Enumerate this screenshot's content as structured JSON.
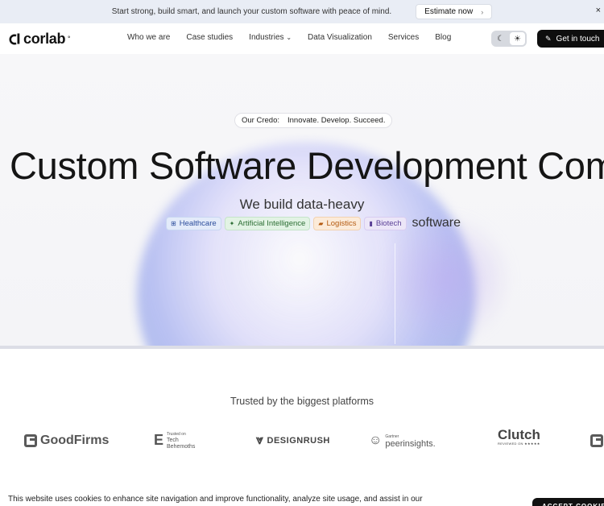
{
  "announcement": {
    "message": "Start strong, build smart, and launch your custom software with peace of mind.",
    "cta_label": "Estimate now",
    "close_symbol": "×"
  },
  "header": {
    "logo_text": "corlab",
    "nav": [
      {
        "label": "Who we are"
      },
      {
        "label": "Case studies"
      },
      {
        "label": "Industries",
        "has_dropdown": true
      },
      {
        "label": "Data Visualization"
      },
      {
        "label": "Services"
      },
      {
        "label": "Blog"
      }
    ],
    "theme_toggle": {
      "selected": "light"
    },
    "get_in_touch": "Get in touch"
  },
  "hero": {
    "credo_label": "Our Credo:",
    "credo_text": "Innovate. Develop. Succeed.",
    "title": "Custom Software Development Company",
    "subtitle": "We build data-heavy",
    "tags": [
      {
        "label": "Healthcare",
        "color": "#2b4c9b"
      },
      {
        "label": "Artificial Intelligence",
        "color": "#2c6e34"
      },
      {
        "label": "Logistics",
        "color": "#b45a10"
      },
      {
        "label": "Biotech",
        "color": "#5a3f96"
      }
    ],
    "suffix": "software"
  },
  "trusted": {
    "heading": "Trusted by the biggest platforms",
    "logos": [
      {
        "name": "GoodFirms"
      },
      {
        "name": "Trusted on",
        "line2": "Tech",
        "line3": "Behemoths"
      },
      {
        "name": "DESIGNRUSH"
      },
      {
        "name": "Gartner",
        "line2": "peerinsights."
      },
      {
        "name": "Clutch",
        "line2": "REVIEWED ON ★★★★★"
      }
    ]
  },
  "cookie": {
    "text": "This website uses cookies to enhance site navigation and improve functionality, analyze site usage, and assist in our marketing",
    "accept_label": "ACCEPT COOKIES"
  }
}
